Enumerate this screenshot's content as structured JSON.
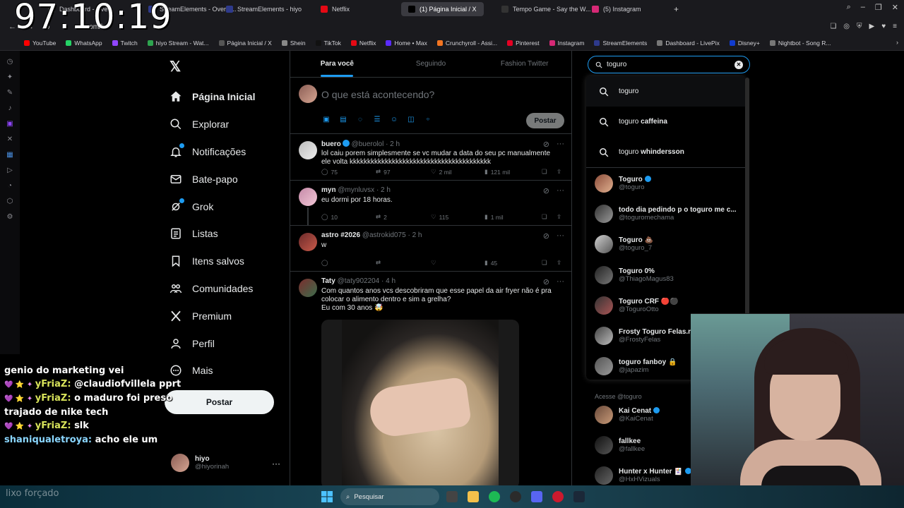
{
  "overlay": {
    "timer": "97:10:19"
  },
  "browser": {
    "tabs": [
      {
        "label": "Dashboard - Live...",
        "color": "#333"
      },
      {
        "label": "StreamElements - Overla...",
        "color": "#2e3a8c"
      },
      {
        "label": "StreamElements - hiyo",
        "color": "#2e3a8c"
      },
      {
        "label": "Netflix",
        "color": "#e50914"
      },
      {
        "label": "(1) Página Inicial / X",
        "color": "#000"
      },
      {
        "label": "Tempo Game - Say the W...",
        "color": "#333"
      },
      {
        "label": "(5) Instagram",
        "color": "#d62976"
      }
    ],
    "url_fragment": "com/h",
    "bookmarks": [
      {
        "label": "YouTube",
        "color": "#ff0000"
      },
      {
        "label": "WhatsApp",
        "color": "#25d366"
      },
      {
        "label": "Twitch",
        "color": "#9146ff"
      },
      {
        "label": "hiyo Stream - Wat...",
        "color": "#2ea44f"
      },
      {
        "label": "Página Inicial / X",
        "color": "#555"
      },
      {
        "label": "Shein",
        "color": "#888"
      },
      {
        "label": "TikTok",
        "color": "#111"
      },
      {
        "label": "Netflix",
        "color": "#e50914"
      },
      {
        "label": "Home • Max",
        "color": "#5a2bff"
      },
      {
        "label": "Crunchyroll - Assi...",
        "color": "#f47521"
      },
      {
        "label": "Pinterest",
        "color": "#e60023"
      },
      {
        "label": "Instagram",
        "color": "#d62976"
      },
      {
        "label": "StreamElements",
        "color": "#2e3a8c"
      },
      {
        "label": "Dashboard - LivePix",
        "color": "#777"
      },
      {
        "label": "Disney+",
        "color": "#113ccf"
      },
      {
        "label": "Nightbot - Song R...",
        "color": "#777"
      }
    ]
  },
  "xnav": {
    "items": [
      {
        "label": "Página Inicial",
        "icon": "home-icon"
      },
      {
        "label": "Explorar",
        "icon": "search-icon"
      },
      {
        "label": "Notificações",
        "icon": "bell-icon"
      },
      {
        "label": "Bate-papo",
        "icon": "mail-icon"
      },
      {
        "label": "Grok",
        "icon": "grok-icon"
      },
      {
        "label": "Listas",
        "icon": "list-icon"
      },
      {
        "label": "Itens salvos",
        "icon": "bookmark-icon"
      },
      {
        "label": "Comunidades",
        "icon": "communities-icon"
      },
      {
        "label": "Premium",
        "icon": "x-icon"
      },
      {
        "label": "Perfil",
        "icon": "person-icon"
      },
      {
        "label": "Mais",
        "icon": "more-icon"
      }
    ],
    "post_button": "Postar",
    "me": {
      "name": "hiyo",
      "handle": "@hiyorinah"
    }
  },
  "chat": [
    {
      "user": "",
      "text": "genio do marketing vei"
    },
    {
      "user": "yFriaZ:",
      "text": "@claudiofvillela pprt"
    },
    {
      "user": "yFriaZ:",
      "text": "o maduro foi preso trajado de nike tech"
    },
    {
      "user": "yFriaZ:",
      "text": "slk"
    },
    {
      "user": "shaniqualetroya:",
      "text": "acho ele um"
    }
  ],
  "chat_tail": "lixo forçado",
  "timeline": {
    "tabs": [
      "Para você",
      "Seguindo",
      "Fashion Twitter"
    ],
    "composer_placeholder": "O que está acontecendo?",
    "post_button": "Postar",
    "tweets": [
      {
        "name": "buero",
        "handle": "@buerolol · 2 h",
        "verified": true,
        "text": "lol caiu porem simplesmente se vc mudar a data do seu pc manualmente ele volta kkkkkkkkkkkkkkkkkkkkkkkkkkkkkkkkkkkkkkkk",
        "replies": "75",
        "reposts": "97",
        "likes": "2 mil",
        "views": "121 mil"
      },
      {
        "name": "myn",
        "handle": "@mynluvsx · 2 h",
        "verified": false,
        "text": "eu dormi por 18 horas.",
        "replies": "10",
        "reposts": "2",
        "likes": "115",
        "views": "1 mil"
      },
      {
        "name": "astro #2026",
        "handle": "@astrokid075 · 2 h",
        "verified": false,
        "text": "w",
        "replies": "",
        "reposts": "",
        "likes": "",
        "views": "45"
      },
      {
        "name": "Taty",
        "handle": "@taty902204 · 4 h",
        "verified": false,
        "text": "Com quantos anos vcs descobriram que esse papel da air fryer não é pra colocar o alimento dentro e sim a grelha?",
        "text2": "Eu com 30 anos 🤯"
      }
    ]
  },
  "search": {
    "value": "toguro",
    "suggestions": [
      {
        "pre": "toguro",
        "bold": ""
      },
      {
        "pre": "toguro ",
        "bold": "caffeina"
      },
      {
        "pre": "toguro ",
        "bold": "whindersson"
      }
    ],
    "users": [
      {
        "name": "Toguro",
        "handle": "@toguro",
        "verified": true
      },
      {
        "name": "todo dia pedindo p o toguro me c...",
        "handle": "@toguromechama",
        "verified": false
      },
      {
        "name": "Toguro 💩",
        "handle": "@toguro_7",
        "verified": false
      },
      {
        "name": "Toguro 0%",
        "handle": "@ThiagoMagus83",
        "verified": false
      },
      {
        "name": "Toguro CRF 🔴⚫",
        "handle": "@ToguroOtto",
        "verified": false
      },
      {
        "name": "Frosty Toguro Felas.rr",
        "handle": "@FrostyFelas",
        "verified": false
      },
      {
        "name": "toguro fanboy 🔒",
        "handle": "@japazim",
        "verified": false
      }
    ],
    "accounts_label": "Acesse @toguro",
    "follow": [
      {
        "name": "Kai Cenat",
        "handle": "@KaiCenat",
        "verified": true
      },
      {
        "name": "fallkee",
        "handle": "@fallkee",
        "verified": false
      },
      {
        "name": "Hunter x Hunter 🃏",
        "handle": "@HxHVizuals",
        "verified": true
      }
    ]
  },
  "taskbar": {
    "search_label": "Pesquisar"
  }
}
